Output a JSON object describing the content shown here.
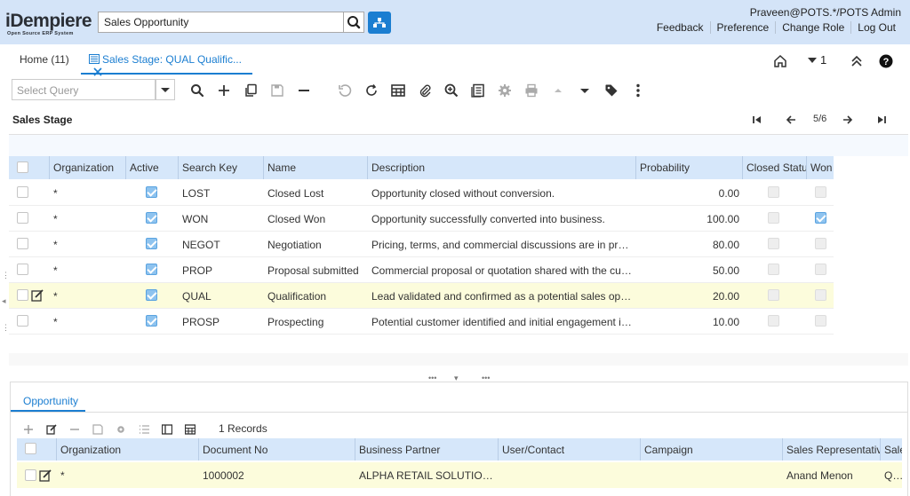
{
  "app": {
    "logo_text": "iDempiere",
    "logo_subtext": "Open Source ERP System",
    "search_value": "Sales Opportunity",
    "user": "Praveen@POTS.*/POTS Admin",
    "links": [
      "Feedback",
      "Preference",
      "Change Role",
      "Log Out"
    ]
  },
  "tabs": {
    "home_label": "Home (11)",
    "active_label": "Sales Stage: QUAL Qualific...",
    "counter": "1"
  },
  "toolbar": {
    "select_query_placeholder": "Select Query",
    "icons": [
      "search-icon",
      "new-icon",
      "copy-icon",
      "save-icon",
      "delete-icon",
      "undo-icon",
      "refresh-icon",
      "grid-toggle-icon",
      "attachment-icon",
      "zoom-icon",
      "report-icon",
      "process-icon",
      "print-icon",
      "up-icon",
      "down-icon",
      "tag-icon",
      "more-icon"
    ]
  },
  "window": {
    "title": "Sales Stage",
    "record_nav": "5/6"
  },
  "grid": {
    "columns": [
      "Organization",
      "Active",
      "Search Key",
      "Name",
      "Description",
      "Probability",
      "Closed Status",
      "Won"
    ],
    "rows": [
      {
        "org": "*",
        "active": true,
        "key": "LOST",
        "name": "Closed Lost",
        "desc": "Opportunity closed without conversion.",
        "prob": "0.00",
        "closed": false,
        "won": false,
        "selected": false
      },
      {
        "org": "*",
        "active": true,
        "key": "WON",
        "name": "Closed Won",
        "desc": "Opportunity successfully converted into business.",
        "prob": "100.00",
        "closed": false,
        "won": true,
        "selected": false
      },
      {
        "org": "*",
        "active": true,
        "key": "NEGOT",
        "name": "Negotiation",
        "desc": "Pricing, terms, and commercial discussions are in progress.",
        "prob": "80.00",
        "closed": false,
        "won": false,
        "selected": false
      },
      {
        "org": "*",
        "active": true,
        "key": "PROP",
        "name": "Proposal submitted",
        "desc": "Commercial proposal or quotation shared with the customer.",
        "prob": "50.00",
        "closed": false,
        "won": false,
        "selected": false
      },
      {
        "org": "*",
        "active": true,
        "key": "QUAL",
        "name": "Qualification",
        "desc": "Lead validated and confirmed as a potential sales opportu...",
        "prob": "20.00",
        "closed": false,
        "won": false,
        "selected": true
      },
      {
        "org": "*",
        "active": true,
        "key": "PROSP",
        "name": "Prospecting",
        "desc": "Potential customer identified and initial engagement init...",
        "prob": "10.00",
        "closed": false,
        "won": false,
        "selected": false
      }
    ]
  },
  "detail": {
    "tab_label": "Opportunity",
    "records": "1 Records",
    "columns": [
      "Organization",
      "Document No",
      "Business Partner",
      "User/Contact",
      "Campaign",
      "Sales Representative",
      "Sale"
    ],
    "row": {
      "org": "*",
      "docno": "1000002",
      "bpartner": "ALPHA RETAIL SOLUTIONS",
      "contact": "",
      "campaign": "",
      "salesrep": "Anand Menon",
      "sale": "Qua"
    }
  },
  "colors": {
    "accent": "#1b7ed1",
    "header_bg": "#d4e4f8",
    "grid_header": "#d6e7fa",
    "selected_row": "#fcfcdc"
  }
}
